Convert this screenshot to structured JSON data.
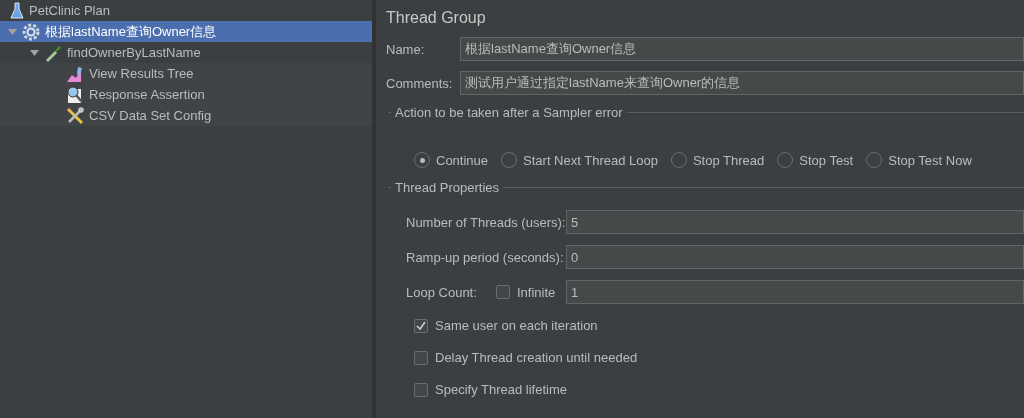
{
  "tree": [
    {
      "label": "PetClinic Plan",
      "kind": "plan",
      "selected": false,
      "children": [
        {
          "label": "根据lastName查询Owner信息",
          "kind": "thread-group",
          "selected": true,
          "expanded": true,
          "children": [
            {
              "label": "findOwnerByLastName",
              "kind": "sampler",
              "selected": false,
              "expanded": true,
              "children": [
                {
                  "label": "View Results Tree",
                  "kind": "listener",
                  "selected": false
                },
                {
                  "label": "Response Assertion",
                  "kind": "assertion",
                  "selected": false
                },
                {
                  "label": "CSV Data Set Config",
                  "kind": "config",
                  "selected": false
                }
              ]
            }
          ]
        }
      ]
    }
  ],
  "panel": {
    "title": "Thread Group",
    "name": {
      "label": "Name:",
      "value": "根据lastName查询Owner信息"
    },
    "comments": {
      "label": "Comments:",
      "value": "测试用户通过指定lastName来查询Owner的信息"
    },
    "error_action": {
      "title": "Action to be taken after a Sampler error",
      "options": [
        {
          "label": "Continue",
          "selected": true
        },
        {
          "label": "Start Next Thread Loop",
          "selected": false
        },
        {
          "label": "Stop Thread",
          "selected": false
        },
        {
          "label": "Stop Test",
          "selected": false
        },
        {
          "label": "Stop Test Now",
          "selected": false
        }
      ]
    },
    "thread_properties": {
      "title": "Thread Properties",
      "threads": {
        "label": "Number of Threads (users):",
        "value": "5"
      },
      "ramp_up": {
        "label": "Ramp-up period (seconds):",
        "value": "0"
      },
      "loop_count": {
        "label": "Loop Count:",
        "infinite": {
          "label": "Infinite",
          "checked": false
        },
        "value": "1"
      },
      "options": [
        {
          "label": "Same user on each iteration",
          "checked": true
        },
        {
          "label": "Delay Thread creation until needed",
          "checked": false
        },
        {
          "label": "Specify Thread lifetime",
          "checked": false
        }
      ]
    }
  }
}
